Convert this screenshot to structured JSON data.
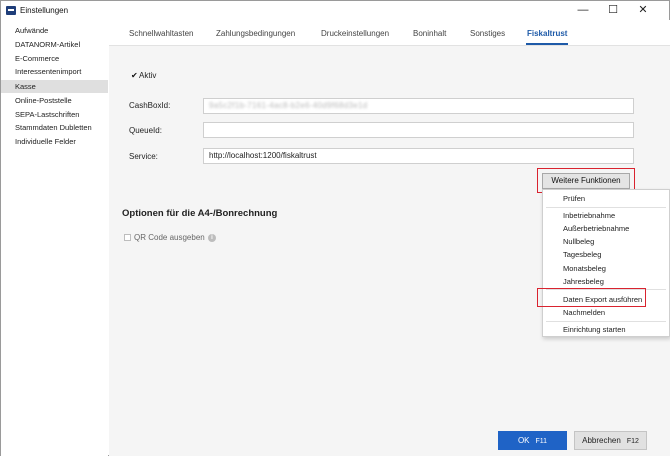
{
  "window": {
    "title": "Einstellungen",
    "controls": {
      "minimize": "—",
      "maximize": "☐",
      "close": "✕"
    }
  },
  "sidebar": {
    "items": [
      {
        "label": "Aufwände"
      },
      {
        "label": "DATANORM-Artikel"
      },
      {
        "label": "E-Commerce"
      },
      {
        "label": "Interessentenimport"
      },
      {
        "label": "Kasse",
        "selected": true
      },
      {
        "label": "Online-Poststelle"
      },
      {
        "label": "SEPA-Lastschriften"
      },
      {
        "label": "Stammdaten Dubletten"
      },
      {
        "label": "Individuelle Felder"
      }
    ]
  },
  "tabs": [
    {
      "label": "Schnellwahltasten"
    },
    {
      "label": "Zahlungsbedingungen"
    },
    {
      "label": "Druckeinstellungen"
    },
    {
      "label": "Boninhalt"
    },
    {
      "label": "Sonstiges"
    },
    {
      "label": "Fiskaltrust",
      "active": true
    }
  ],
  "form": {
    "aktiv_check": "✔",
    "aktiv_label": "Aktiv",
    "cashboxid_label": "CashBoxId:",
    "cashboxid_value": "9a5c2f1b-7161-4ac8-b2e6-40d9f68d3e1d",
    "queueid_label": "QueueId:",
    "queueid_value": "",
    "service_label": "Service:",
    "service_value": "http://localhost:1200/fiskaltrust",
    "weitere_button": "Weitere Funktionen"
  },
  "options": {
    "section_title": "Optionen für die A4-/Bonrechnung",
    "qr_label": "QR Code ausgeben",
    "qr_checked": false,
    "info_glyph": "i"
  },
  "menu": {
    "items": [
      {
        "label": "Prüfen"
      },
      {
        "label": "Inbetriebnahme"
      },
      {
        "label": "Außerbetriebnahme"
      },
      {
        "label": "Nullbeleg"
      },
      {
        "label": "Tagesbeleg"
      },
      {
        "label": "Monatsbeleg"
      },
      {
        "label": "Jahresbeleg"
      },
      {
        "label": "Daten Export ausführen"
      },
      {
        "label": "Nachmelden"
      },
      {
        "label": "Einrichtung starten"
      }
    ]
  },
  "footer": {
    "ok_label": "OK",
    "ok_key": "F11",
    "cancel_label": "Abbrechen",
    "cancel_key": "F12"
  },
  "colors": {
    "accent": "#1e5aa8",
    "ok_button": "#1f63c6",
    "highlight_frame": "#d9232f",
    "selected_sidebar": "#dfdfdf"
  },
  "icons": [
    "app-icon",
    "check-icon",
    "info-icon",
    "minimize-icon",
    "maximize-icon",
    "close-icon"
  ]
}
